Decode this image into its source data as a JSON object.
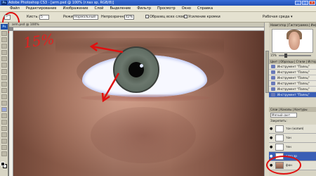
{
  "window": {
    "title": "Adobe Photoshop CS3 - [arm.psd @ 100% (глаз зр, RGB/8)]",
    "app_logo": "Ps",
    "buttons": [
      "_",
      "□",
      "×"
    ]
  },
  "menu": [
    "Файл",
    "Редактирование",
    "Изображение",
    "Слой",
    "Выделение",
    "Фильтр",
    "Просмотр",
    "Окно",
    "Справка"
  ],
  "options": {
    "brush_label": "Кисть:",
    "brush_size": "5",
    "mode_label": "Режим:",
    "mode_value": "Нормальный",
    "opacity_label": "Непрозрачность:",
    "opacity_value": "42%",
    "all_layers_label": "Образец всех слоев",
    "enhance_edge_label": "Усиление кромки",
    "workspace_label": "Рабочая среда ▾"
  },
  "document": {
    "tab": "arm.psd @ 100%",
    "annotation_percent": "15%"
  },
  "navigator": {
    "tabs": "Навигатор | Гистограмма | Инфо",
    "zoom": "15%"
  },
  "history": {
    "tabs": "Цвет | Образцы | Стили | История",
    "items": [
      {
        "label": "Инструмент \"Палец\"",
        "active": false
      },
      {
        "label": "Инструмент \"Палец\"",
        "active": false
      },
      {
        "label": "Инструмент \"Палец\"",
        "active": false
      },
      {
        "label": "Инструмент \"Палец\"",
        "active": false
      },
      {
        "label": "Инструмент \"Палец\"",
        "active": false
      },
      {
        "label": "Инструмент \"Палец\"",
        "active": true
      }
    ]
  },
  "layers": {
    "tabs": "Слои | Каналы | Контуры",
    "blend_mode": "Мягкий свет",
    "lock_label": "Закрепить:",
    "items": [
      {
        "name": "тон (копия)",
        "active": false
      },
      {
        "name": "тон",
        "active": false
      },
      {
        "name": "тен",
        "active": false
      },
      {
        "name": "глаз зр",
        "active": true
      },
      {
        "name": "фон",
        "active": false
      }
    ]
  }
}
